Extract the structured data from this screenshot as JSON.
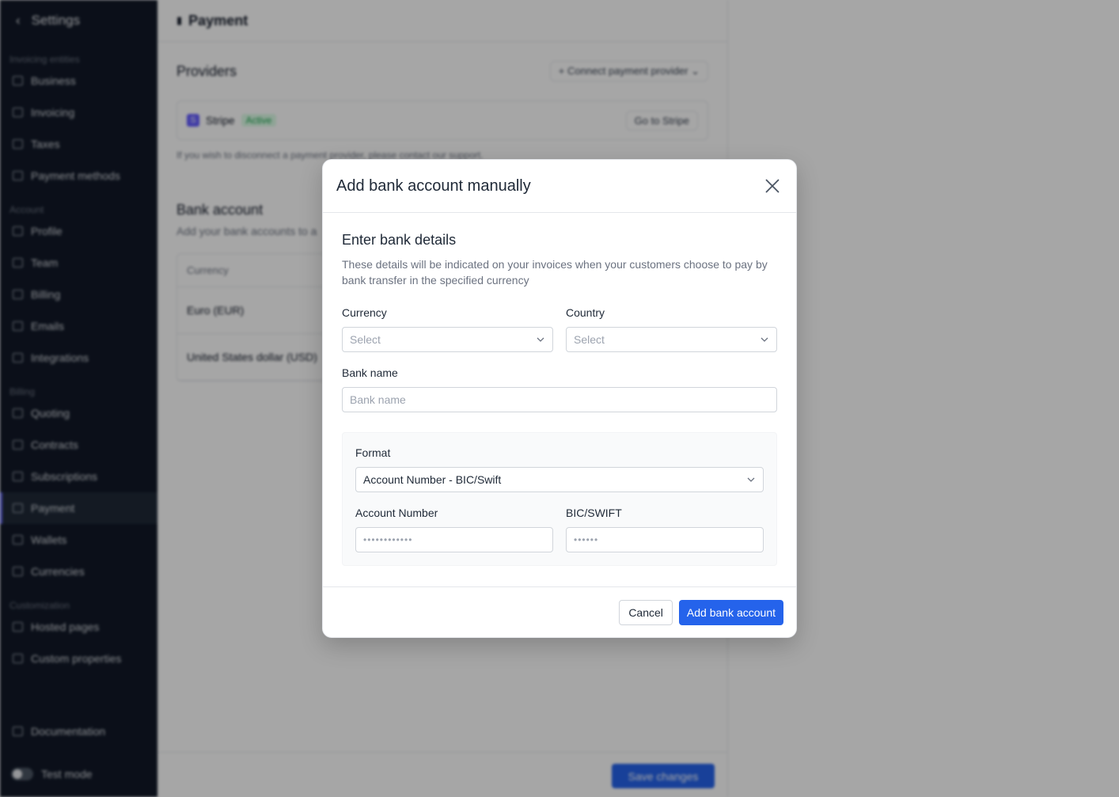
{
  "sidebar": {
    "back_label": "Settings",
    "sections": [
      {
        "title": "Invoicing entities",
        "items": [
          "Business",
          "Invoicing",
          "Taxes",
          "Payment methods"
        ]
      },
      {
        "title": "Account",
        "items": [
          "Profile",
          "Team",
          "Billing",
          "Emails",
          "Integrations"
        ]
      },
      {
        "title": "Billing",
        "items": [
          "Quoting",
          "Contracts",
          "Subscriptions",
          "Payment",
          "Wallets",
          "Currencies"
        ]
      },
      {
        "title": "Customization",
        "items": [
          "Hosted pages",
          "Custom properties"
        ]
      }
    ],
    "active_item": "Payment",
    "documentation": "Documentation",
    "test_mode": "Test mode"
  },
  "page": {
    "title": "Payment",
    "providers_title": "Providers",
    "connect_provider": "Connect payment provider",
    "provider_name": "Stripe",
    "provider_status": "Active",
    "go_to_provider": "Go to Stripe",
    "disconnect_note": "If you wish to disconnect a payment provider, please contact our support.",
    "bank_title": "Bank account",
    "bank_subtitle": "Add your bank accounts to a",
    "bank_table_header": "Currency",
    "bank_rows": [
      "Euro (EUR)",
      "United States dollar (USD)"
    ],
    "save_changes": "Save changes"
  },
  "modal": {
    "title": "Add bank account manually",
    "section_title": "Enter bank details",
    "section_desc": "These details will be indicated on your invoices when your customers choose to pay by bank transfer in the specified currency",
    "currency_label": "Currency",
    "currency_placeholder": "Select",
    "country_label": "Country",
    "country_placeholder": "Select",
    "bank_name_label": "Bank name",
    "bank_name_placeholder": "Bank name",
    "format_label": "Format",
    "format_value": "Account Number - BIC/Swift",
    "account_number_label": "Account Number",
    "account_number_mask": "••••••••••••",
    "bic_label": "BIC/SWIFT",
    "bic_mask": "••••••",
    "cancel_label": "Cancel",
    "submit_label": "Add bank account"
  },
  "colors": {
    "primary": "#2563eb",
    "sidebar_bg": "#111827",
    "active_accent": "#6366f1",
    "status_active": "#16a34a"
  }
}
